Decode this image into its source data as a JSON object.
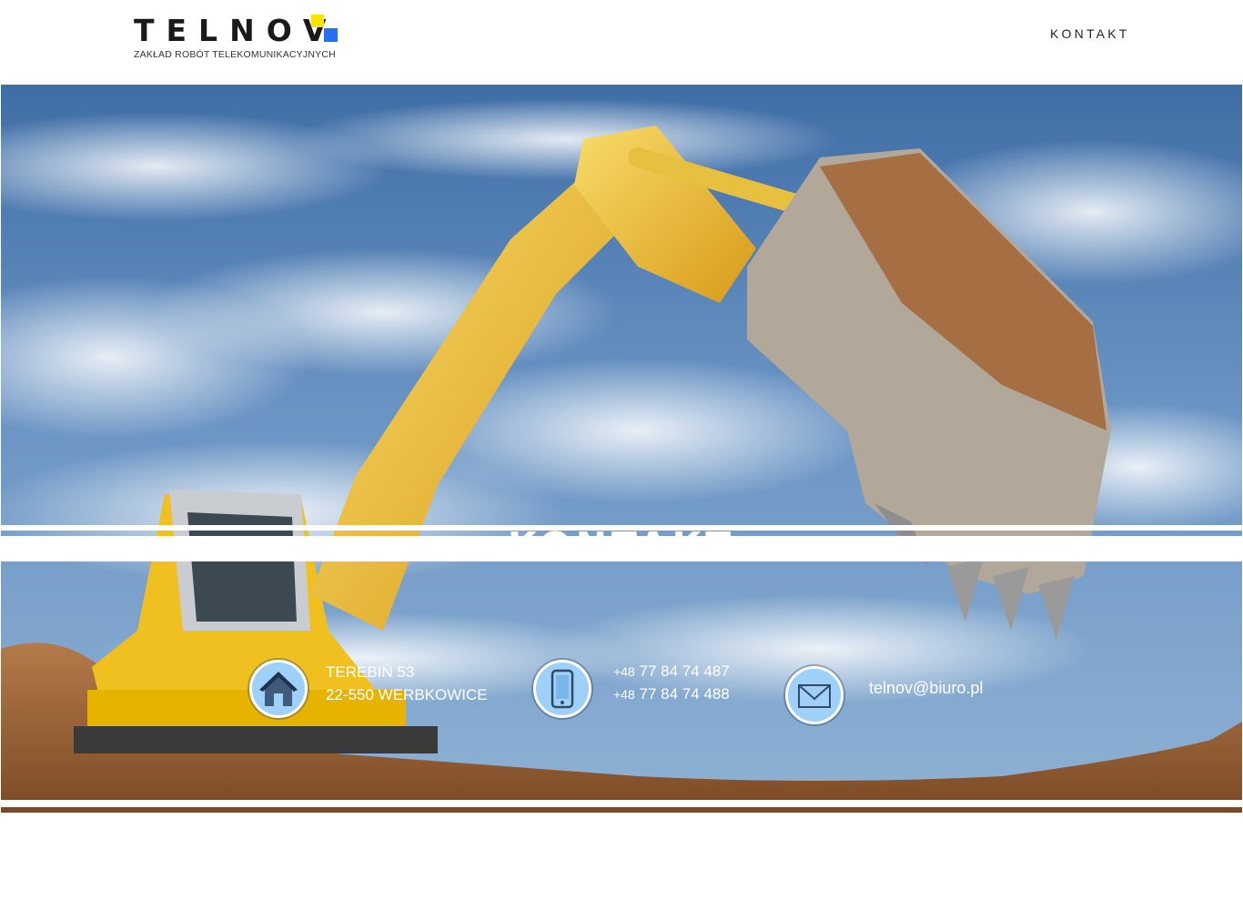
{
  "header": {
    "logo_word": "TELNOV",
    "logo_tagline": "ZAKŁAD ROBÓT TELEKOMUNIKACYJNYCH",
    "nav": [
      {
        "label": "KONTAKT"
      }
    ]
  },
  "hero": {
    "title": "KONTAKT",
    "image": "excavator-sky-photo"
  },
  "contact": {
    "address": {
      "icon": "house-icon",
      "line1": "TEREBIŃ 53",
      "line2": "22-550 WERBKOWICE"
    },
    "phone": {
      "icon": "phone-icon",
      "prefix1": "+48",
      "number1": "77 84 74 487",
      "prefix2": "+48",
      "number2": "77 84 74 488"
    },
    "email": {
      "icon": "envelope-icon",
      "address": "telnov@biuro.pl"
    }
  },
  "colors": {
    "accent_yellow": "#f5e500",
    "accent_blue": "#2a6ff0",
    "icon_circle": "#9fd0f7"
  }
}
